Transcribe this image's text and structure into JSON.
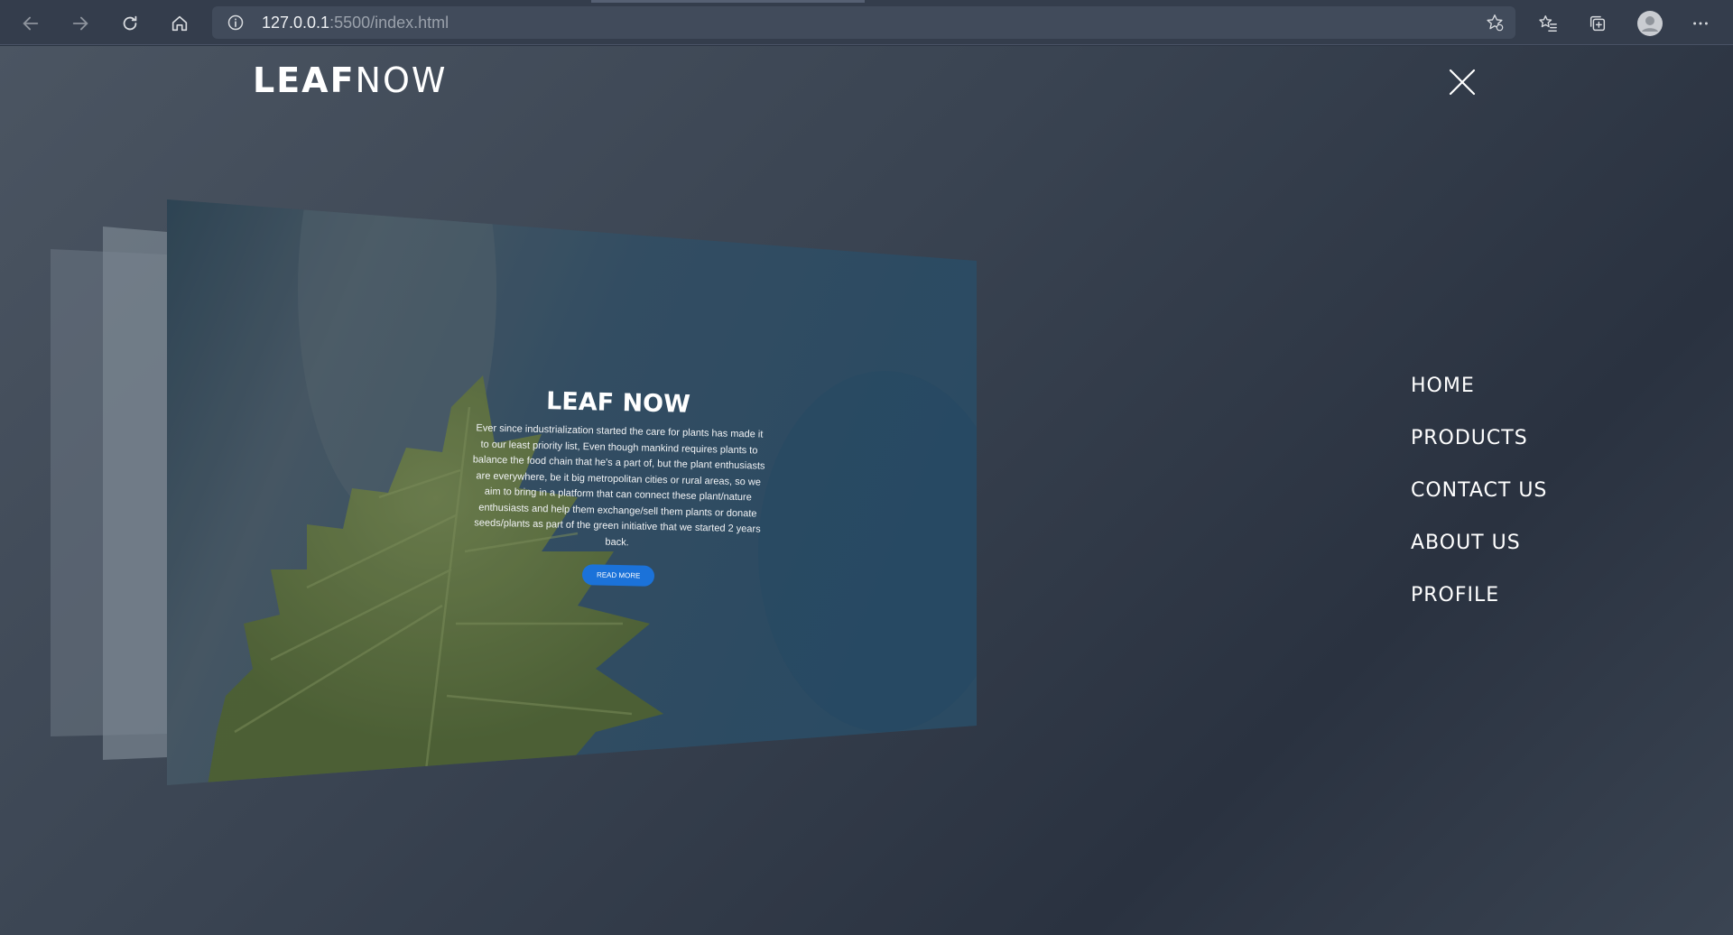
{
  "browser": {
    "url_host": "127.0.0.1",
    "url_rest": ":5500/index.html"
  },
  "site": {
    "logo_bold": "LEAF",
    "logo_light": "NOW"
  },
  "menu": {
    "items": [
      {
        "label": "HOME"
      },
      {
        "label": "PRODUCTS"
      },
      {
        "label": "CONTACT US"
      },
      {
        "label": "ABOUT US"
      },
      {
        "label": "PROFILE"
      }
    ]
  },
  "hero": {
    "title": "LEAF NOW",
    "text": "Ever since industrialization started the care for plants has made it to our least priority list, Even though mankind requires plants to balance the food chain that he's a part of, but the plant enthusiasts are everywhere, be it big metropolitan cities or rural areas, so we aim to bring in a platform that can connect these plant/nature enthusiasts and help them exchange/sell them plants or donate seeds/plants as part of the green initiative that we started 2 years back.",
    "button": "READ MORE"
  },
  "colors": {
    "accent": "#1b72d9",
    "leaf": "#6b7f3a"
  }
}
